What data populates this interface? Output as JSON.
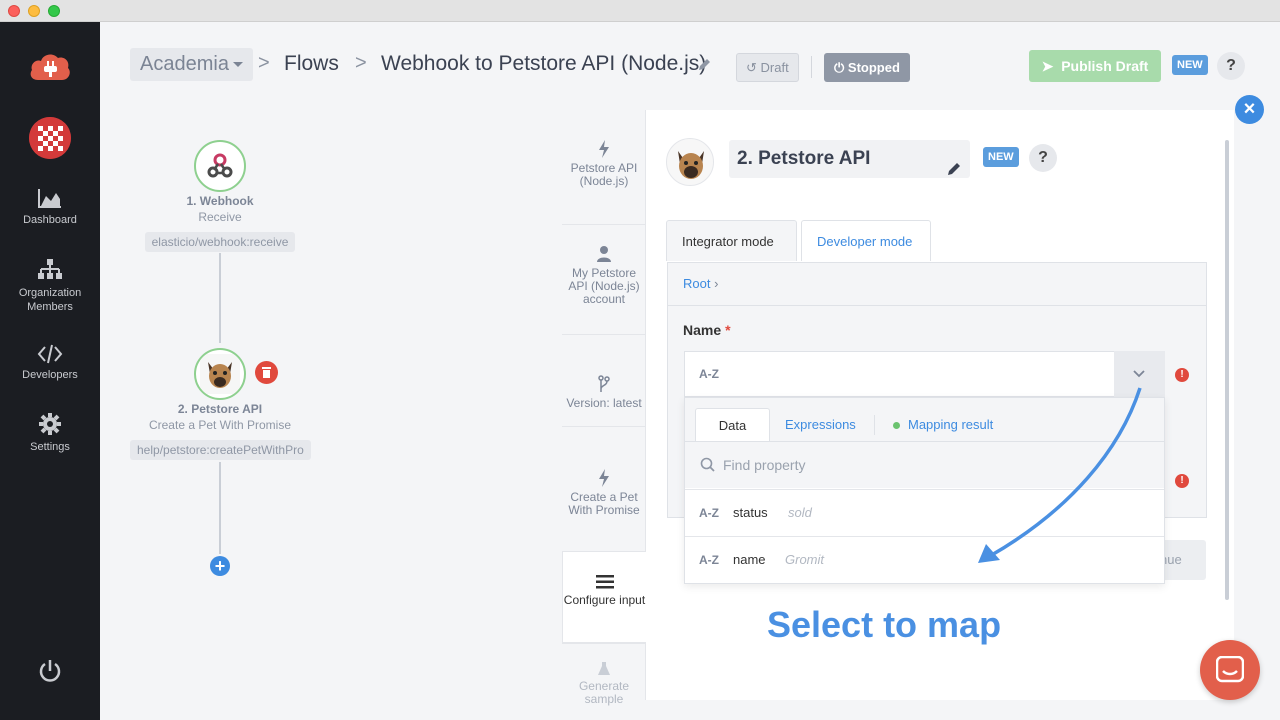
{
  "colors": {
    "sidebar_bg": "#1b1d22",
    "accent_blue": "#3d8be0",
    "brand_red": "#e25f4b",
    "success_green": "#a8dbab",
    "error_red": "#e0493d"
  },
  "sidebar": {
    "items": [
      {
        "label": "Dashboard",
        "icon": "chart-area-icon"
      },
      {
        "label": "Organization Members",
        "icon": "sitemap-icon"
      },
      {
        "label": "Developers",
        "icon": "code-icon"
      },
      {
        "label": "Settings",
        "icon": "gear-icon"
      }
    ]
  },
  "header": {
    "org": "Academia",
    "sep": ">",
    "flows": "Flows",
    "flow_name": "Webhook to Petstore API (Node.js)",
    "draft": "Draft",
    "stopped": "Stopped",
    "publish": "Publish Draft",
    "new_badge": "NEW",
    "help": "?"
  },
  "flow": {
    "node1": {
      "title": "1. Webhook",
      "subtitle": "Receive",
      "tag": "elasticio/webhook:receive"
    },
    "node2": {
      "title": "2. Petstore API",
      "subtitle": "Create a Pet With Promise",
      "tag": "help/petstore:createPetWithPro"
    },
    "add": "+"
  },
  "panel": {
    "close": "×",
    "steps": [
      {
        "label": "Petstore API (Node.js)",
        "icon": "bolt-icon"
      },
      {
        "label": "My Petstore API (Node.js) account",
        "icon": "user-icon"
      },
      {
        "label": "Version: latest",
        "icon": "branch-icon"
      },
      {
        "label": "Create a Pet With Promise",
        "icon": "bolt-icon"
      },
      {
        "label": "Configure input",
        "icon": "list-icon"
      },
      {
        "label": "Generate sample",
        "icon": "flask-icon"
      }
    ],
    "step_name": "2. Petstore API",
    "new_badge": "NEW",
    "help": "?",
    "tabs": {
      "integrator": "Integrator mode",
      "developer": "Developer mode"
    },
    "breadcrumb": "Root",
    "field": {
      "label": "Name",
      "required": "*",
      "type": "A-Z",
      "value": ""
    },
    "continue_fragment": "nue",
    "popup": {
      "tabs": {
        "data": "Data",
        "expressions": "Expressions",
        "mapping": "Mapping result"
      },
      "search_placeholder": "Find property",
      "properties": [
        {
          "type": "A-Z",
          "name": "status",
          "sample": "sold"
        },
        {
          "type": "A-Z",
          "name": "name",
          "sample": "Gromit"
        }
      ]
    }
  },
  "annotation": "Select to map"
}
